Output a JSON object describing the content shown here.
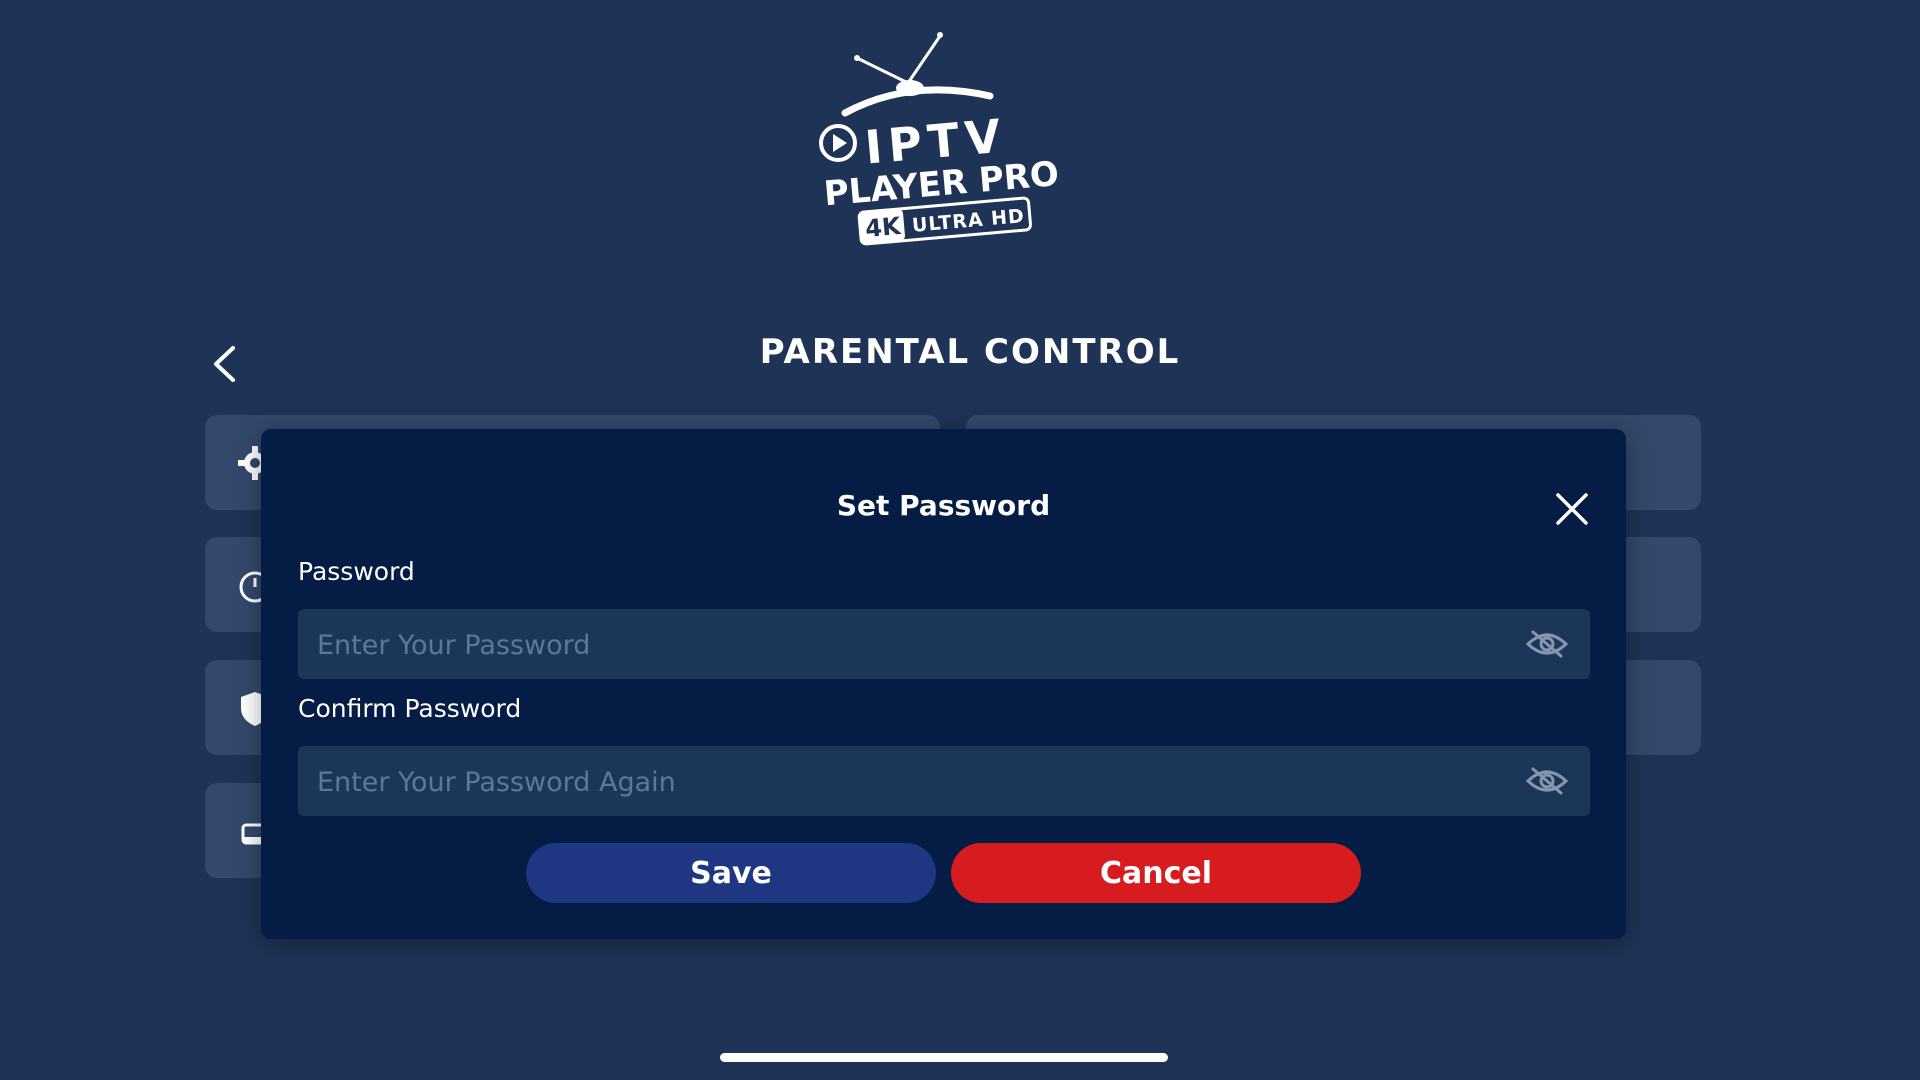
{
  "logo": {
    "line1": "IPTV",
    "line2": "PLAYER PRO",
    "badge_4k": "4K",
    "badge_text": "ULTRA HD"
  },
  "header": {
    "title": "PARENTAL CONTROL",
    "back_icon": "chevron-left-icon"
  },
  "background_cards": {
    "icons": [
      "gear-icon",
      "clock-icon",
      "shield-icon",
      "tv-icon"
    ]
  },
  "modal": {
    "title": "Set Password",
    "close_icon": "close-icon",
    "password": {
      "label": "Password",
      "placeholder": "Enter Your Password",
      "value": "",
      "toggle_icon": "eye-off-icon"
    },
    "confirm_password": {
      "label": "Confirm Password",
      "placeholder": "Enter Your Password Again",
      "value": "",
      "toggle_icon": "eye-off-icon"
    },
    "save_label": "Save",
    "cancel_label": "Cancel"
  },
  "colors": {
    "background": "#1f3357",
    "modal": "#051c45",
    "input": "#1c3659",
    "save_button": "#1f3682",
    "cancel_button": "#d71c1f"
  }
}
